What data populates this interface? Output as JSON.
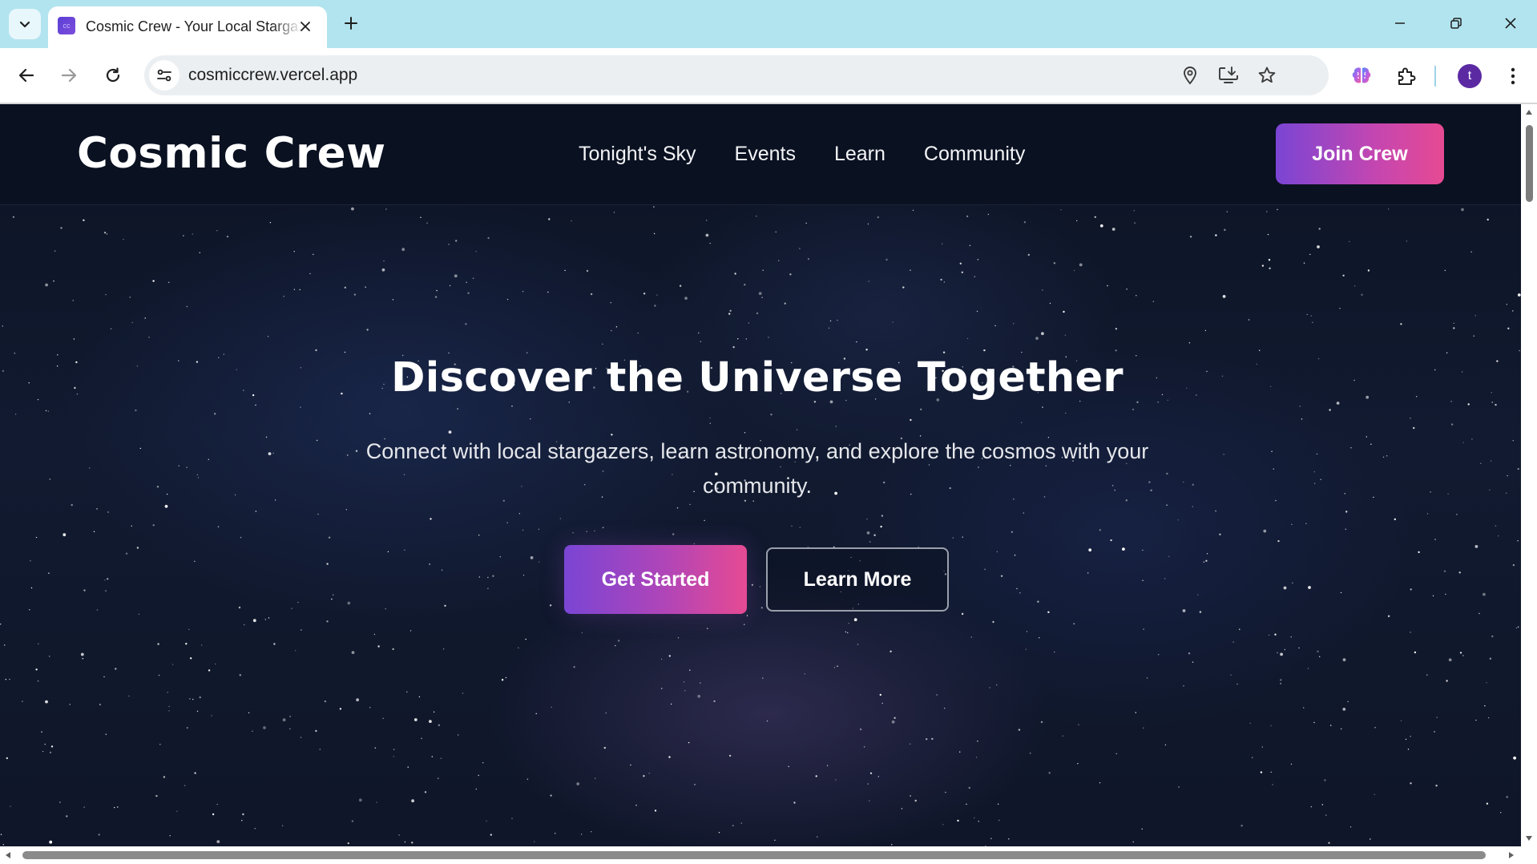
{
  "browser": {
    "tab": {
      "title": "Cosmic Crew - Your Local Stargazers",
      "favicon_text": "cc"
    },
    "omnibox": {
      "url": "cosmiccrew.vercel.app"
    },
    "profile": {
      "initial": "t",
      "color": "#5b2aa3"
    },
    "icons": [
      "tab-list-icon",
      "close-icon",
      "plus-icon",
      "minimize-icon",
      "restore-icon",
      "back-icon",
      "forward-icon",
      "reload-icon",
      "site-info-icon",
      "location-icon",
      "install-app-icon",
      "bookmark-star-icon",
      "extension-brain-icon",
      "puzzle-icon",
      "more-vert-icon"
    ]
  },
  "site": {
    "brand": "Cosmic Crew",
    "nav": [
      {
        "label": "Tonight's Sky"
      },
      {
        "label": "Events"
      },
      {
        "label": "Learn"
      },
      {
        "label": "Community"
      }
    ],
    "join_label": "Join Crew",
    "hero": {
      "title": "Discover the Universe Together",
      "subtitle": "Connect with local stargazers, learn astronomy, and explore the cosmos with your community.",
      "primary_cta": "Get Started",
      "secondary_cta": "Learn More"
    },
    "colors": {
      "header_bg": "#0a1121",
      "gradient_start": "#7a45d4",
      "gradient_end": "#e64a93"
    }
  }
}
